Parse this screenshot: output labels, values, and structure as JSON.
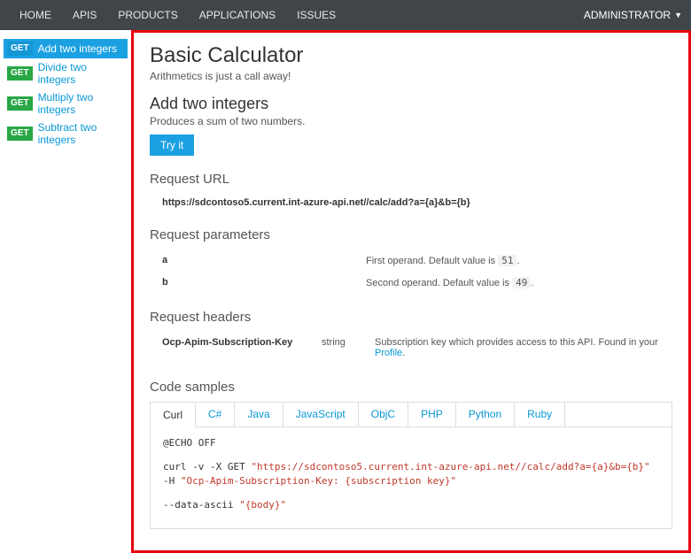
{
  "nav": {
    "items": [
      "HOME",
      "APIS",
      "PRODUCTS",
      "APPLICATIONS",
      "ISSUES"
    ],
    "user": "ADMINISTRATOR"
  },
  "sidebar": {
    "items": [
      {
        "method": "GET",
        "label": "Add two integers",
        "active": true
      },
      {
        "method": "GET",
        "label": "Divide two integers",
        "active": false
      },
      {
        "method": "GET",
        "label": "Multiply two integers",
        "active": false
      },
      {
        "method": "GET",
        "label": "Subtract two integers",
        "active": false
      }
    ]
  },
  "page": {
    "title": "Basic Calculator",
    "subtitle": "Arithmetics is just a call away!"
  },
  "operation": {
    "title": "Add two integers",
    "desc": "Produces a sum of two numbers.",
    "try_label": "Try it"
  },
  "request_url": {
    "heading": "Request URL",
    "url": "https://sdcontoso5.current.int-azure-api.net//calc/add?a={a}&b={b}"
  },
  "params": {
    "heading": "Request parameters",
    "rows": [
      {
        "name": "a",
        "desc_prefix": "First operand. Default value is",
        "default": "51"
      },
      {
        "name": "b",
        "desc_prefix": "Second operand. Default value is",
        "default": "49"
      }
    ]
  },
  "headers": {
    "heading": "Request headers",
    "rows": [
      {
        "name": "Ocp-Apim-Subscription-Key",
        "type": "string",
        "desc": "Subscription key which provides access to this API. Found in your",
        "link": "Profile",
        "suffix": "."
      }
    ]
  },
  "code": {
    "heading": "Code samples",
    "tabs": [
      "Curl",
      "C#",
      "Java",
      "JavaScript",
      "ObjC",
      "PHP",
      "Python",
      "Ruby"
    ],
    "active_tab": "Curl",
    "lines": {
      "l1": "@ECHO OFF",
      "l2a": "curl -v -X GET ",
      "l2b": "\"https://sdcontoso5.current.int-azure-api.net//calc/add?a={a}&b={b}\"",
      "l3a": "-H ",
      "l3b": "\"Ocp-Apim-Subscription-Key: {subscription key}\"",
      "l4a": "--data-ascii ",
      "l4b": "\"{body}\""
    }
  }
}
